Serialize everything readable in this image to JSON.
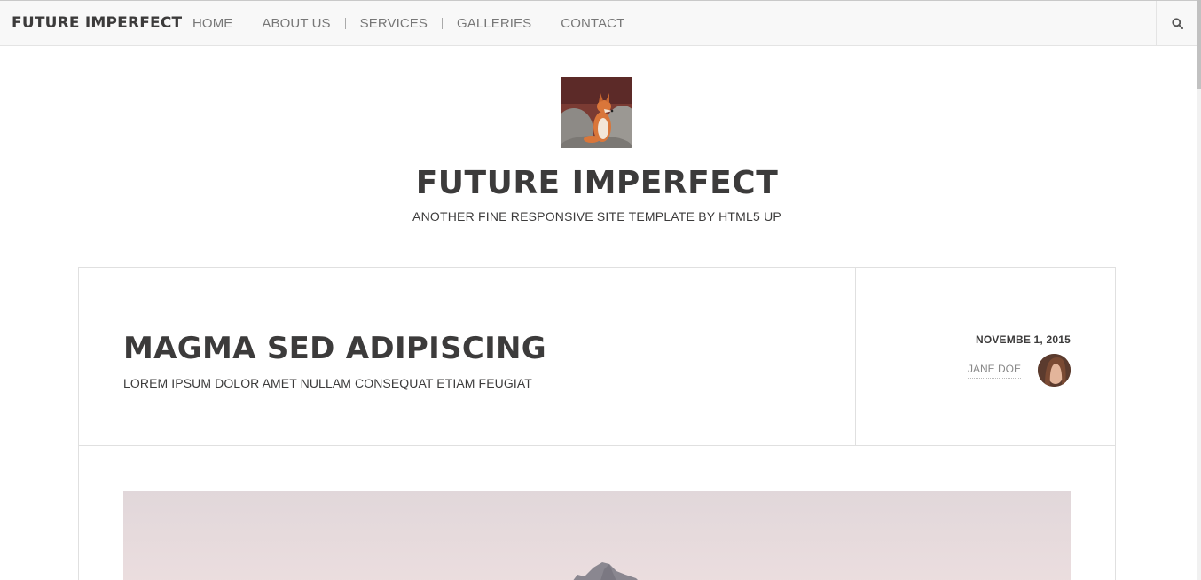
{
  "header": {
    "brand": "FUTURE IMPERFECT",
    "nav": [
      {
        "label": "HOME"
      },
      {
        "label": "ABOUT US"
      },
      {
        "label": "SERVICES"
      },
      {
        "label": "GALLERIES"
      },
      {
        "label": "CONTACT"
      }
    ],
    "search_icon": "search-icon"
  },
  "intro": {
    "logo_image": "fox-photo",
    "title": "FUTURE IMPERFECT",
    "tagline": "ANOTHER FINE RESPONSIVE SITE TEMPLATE BY HTML5 UP"
  },
  "post": {
    "title": "MAGMA SED ADIPISCING",
    "subtitle": "LOREM IPSUM DOLOR AMET NULLAM CONSEQUAT ETIAM FEUGIAT",
    "date": "NOVEMBE 1, 2015",
    "author": "JANE DOE",
    "avatar_image": "author-portrait",
    "featured_image": "mountain-landscape"
  },
  "colors": {
    "text": "#3c3b3b",
    "nav_text": "#777777",
    "border": "#e0e0e0",
    "header_bg": "#f8f8f8"
  }
}
